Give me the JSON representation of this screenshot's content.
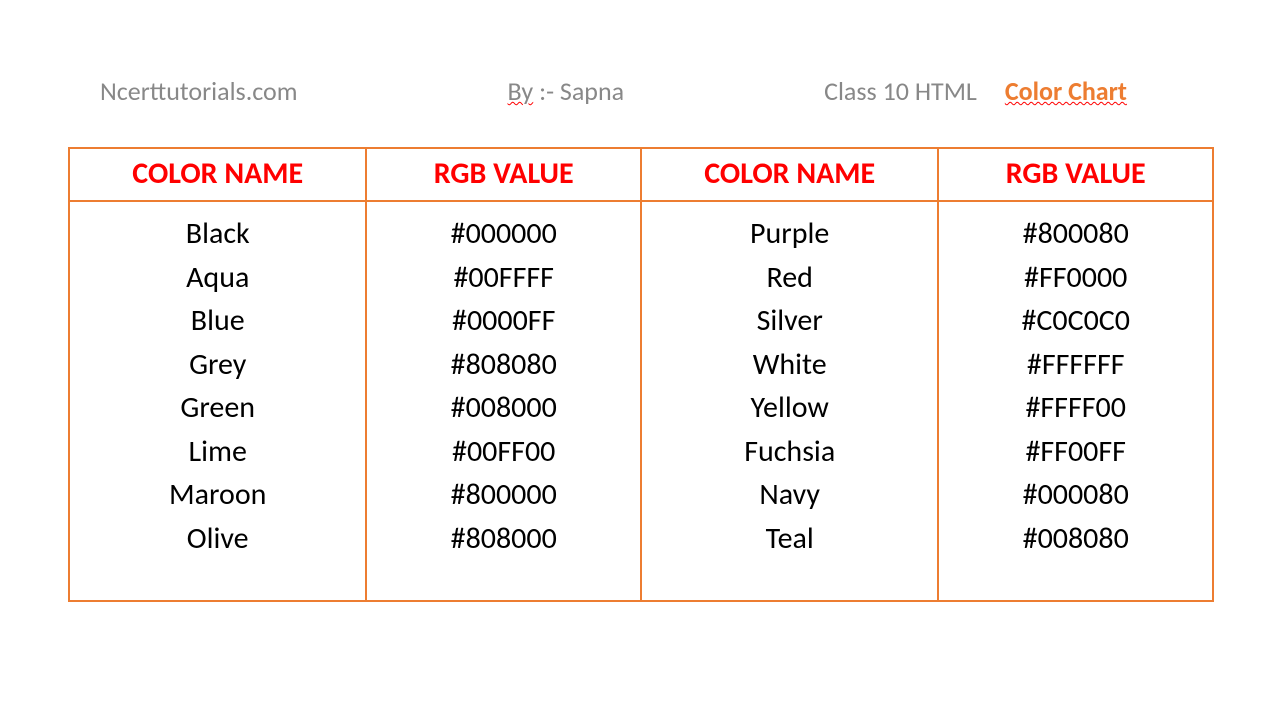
{
  "header": {
    "site": "Ncerttutorials.com",
    "author_prefix": "By",
    "author_name": ":- Sapna",
    "class_label": "Class 10 HTML",
    "page_title": "Color Chart"
  },
  "table": {
    "columns": [
      "COLOR NAME",
      "RGB VALUE",
      "COLOR NAME",
      "RGB VALUE"
    ],
    "left": [
      {
        "name": "Black",
        "rgb": "#000000"
      },
      {
        "name": "Aqua",
        "rgb": "#00FFFF"
      },
      {
        "name": "Blue",
        "rgb": "#0000FF"
      },
      {
        "name": "Grey",
        "rgb": "#808080"
      },
      {
        "name": "Green",
        "rgb": "#008000"
      },
      {
        "name": "Lime",
        "rgb": "#00FF00"
      },
      {
        "name": "Maroon",
        "rgb": "#800000"
      },
      {
        "name": "Olive",
        "rgb": "#808000"
      }
    ],
    "right": [
      {
        "name": "Purple",
        "rgb": "#800080"
      },
      {
        "name": "Red",
        "rgb": "#FF0000"
      },
      {
        "name": "Silver",
        "rgb": "#C0C0C0"
      },
      {
        "name": "White",
        "rgb": "#FFFFFF"
      },
      {
        "name": "Yellow",
        "rgb": "#FFFF00"
      },
      {
        "name": "Fuchsia",
        "rgb": "#FF00FF"
      },
      {
        "name": "Navy",
        "rgb": "#000080"
      },
      {
        "name": "Teal",
        "rgb": "#008080"
      }
    ]
  }
}
